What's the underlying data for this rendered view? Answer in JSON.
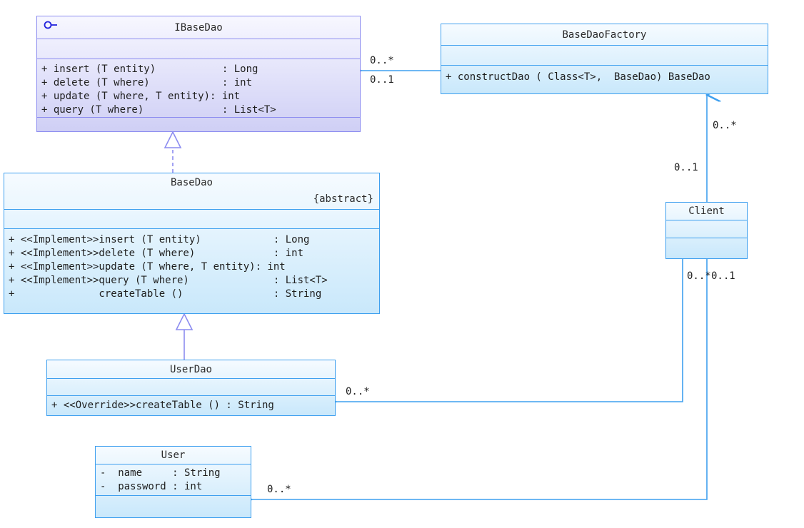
{
  "diagram": {
    "type": "uml-class-diagram",
    "title": "",
    "colors": {
      "class_border": "#3fa0ef",
      "class_fill_top": "#f6fbff",
      "class_fill_bottom": "#c9e8fb",
      "interface_border": "#8c8cf0",
      "interface_fill_top": "#f7f7ff",
      "interface_fill_bottom": "#cfcff5",
      "edge": "#3fa0ef",
      "realization_edge": "#8c8cf0",
      "text": "#1e1e1e",
      "background": "#ffffff"
    }
  },
  "classes": {
    "ibasedao": {
      "name": "IBaseDao",
      "icon": "interface-lollipop-icon",
      "stereotype": "",
      "attributes": [],
      "methods": [
        "+ insert (T entity)           : Long",
        "+ delete (T where)            : int",
        "+ update (T where, T entity): int",
        "+ query (T where)             : List<T>"
      ]
    },
    "basedaofactory": {
      "name": "BaseDaoFactory",
      "stereotype": "",
      "attributes": [],
      "methods": [
        "+ constructDao ( Class<T>,  BaseDao) BaseDao"
      ]
    },
    "basedao": {
      "name": "BaseDao",
      "stereotype": "{abstract}",
      "attributes": [],
      "methods": [
        "+ <<Implement>>insert (T entity)            : Long",
        "+ <<Implement>>delete (T where)             : int",
        "+ <<Implement>>update (T where, T entity): int",
        "+ <<Implement>>query (T where)              : List<T>",
        "+              createTable ()               : String"
      ]
    },
    "userdao": {
      "name": "UserDao",
      "stereotype": "",
      "attributes": [],
      "methods": [
        "+ <<Override>>createTable () : String"
      ]
    },
    "user": {
      "name": "User",
      "stereotype": "",
      "attributes": [
        "-  name     : String",
        "-  password : int"
      ],
      "methods": []
    },
    "client": {
      "name": "Client",
      "stereotype": "",
      "attributes": [],
      "methods": []
    }
  },
  "multiplicities": {
    "factory_to_ibasedao_source": "0..*",
    "factory_to_ibasedao_target": "0..1",
    "client_to_factory_top": "0..*",
    "client_to_factory_bottom": "0..1",
    "client_to_userdao_near": "0..*",
    "client_to_user_near": "0..1",
    "userdao_arrow": "0..*",
    "user_arrow": "0..*"
  },
  "relations": [
    {
      "name": "basedaofactory-uses-ibasedao",
      "kind": "association-directed",
      "from": "basedaofactory",
      "to": "ibasedao"
    },
    {
      "name": "client-uses-basedaofactory",
      "kind": "association-directed",
      "from": "client",
      "to": "basedaofactory"
    },
    {
      "name": "basedao-realizes-ibasedao",
      "kind": "realization",
      "from": "basedao",
      "to": "ibasedao"
    },
    {
      "name": "userdao-extends-basedao",
      "kind": "generalization",
      "from": "userdao",
      "to": "basedao"
    },
    {
      "name": "client-uses-userdao",
      "kind": "association-directed",
      "from": "client",
      "to": "userdao"
    },
    {
      "name": "client-uses-user",
      "kind": "association-directed",
      "from": "client",
      "to": "user"
    }
  ]
}
